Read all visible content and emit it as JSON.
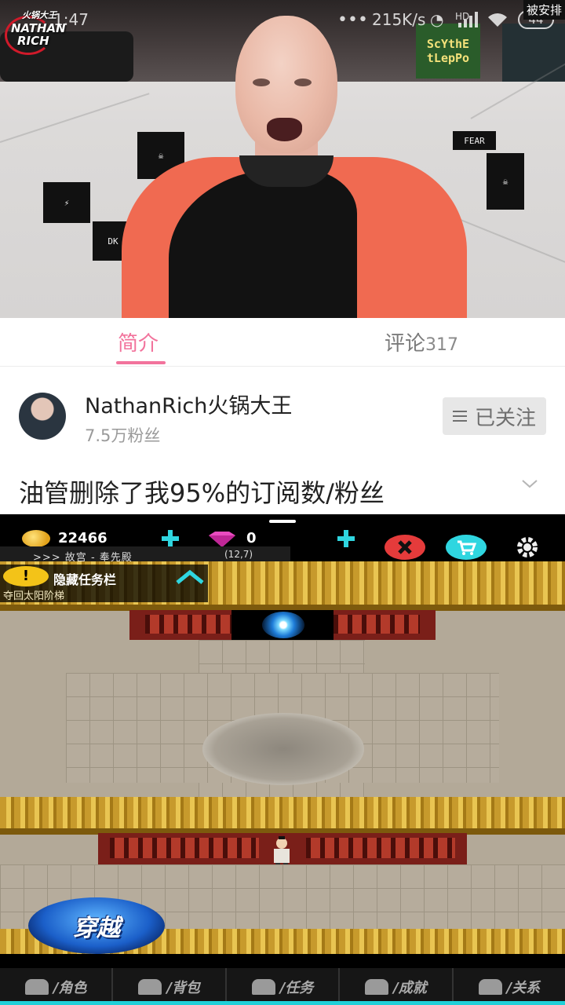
{
  "status_bar": {
    "time": "1:47",
    "net_speed": "215K/s",
    "hd": "HD",
    "battery": "44",
    "overlay_tag": "被安排"
  },
  "video": {
    "watermark_lines": [
      "火锅大王",
      "NATHAN",
      "RICH"
    ],
    "poster_right": [
      "ScYthE",
      "tLepPo"
    ]
  },
  "tabs": {
    "intro": "简介",
    "comments": "评论",
    "comment_count": "317"
  },
  "channel": {
    "name": "NathanRich火锅大王",
    "fans": "7.5万粉丝",
    "follow_label": "已关注"
  },
  "video_title": "油管删除了我95%的订阅数/粉丝",
  "game": {
    "gold": "22466",
    "gems": "0",
    "location": ">>> 故宫 - 奉先殿",
    "coords": "(12,7)",
    "task_panel_title": "隐藏任务栏",
    "task_text": "夺回太阳阶梯",
    "travel_button": "穿越",
    "nav": [
      {
        "label": "/角色",
        "icon": "person-icon"
      },
      {
        "label": "/背包",
        "icon": "bag-icon"
      },
      {
        "label": "/任务",
        "icon": "scroll-icon"
      },
      {
        "label": "/成就",
        "icon": "crown-icon"
      },
      {
        "label": "/关系",
        "icon": "handshake-icon"
      }
    ],
    "colors": {
      "accent": "#2fd6e0",
      "gold": "#f3c318",
      "close": "#e53b3b"
    }
  },
  "colors": {
    "tab_active": "#f2739c",
    "title_text": "#222222",
    "muted": "#9a9a9a"
  }
}
